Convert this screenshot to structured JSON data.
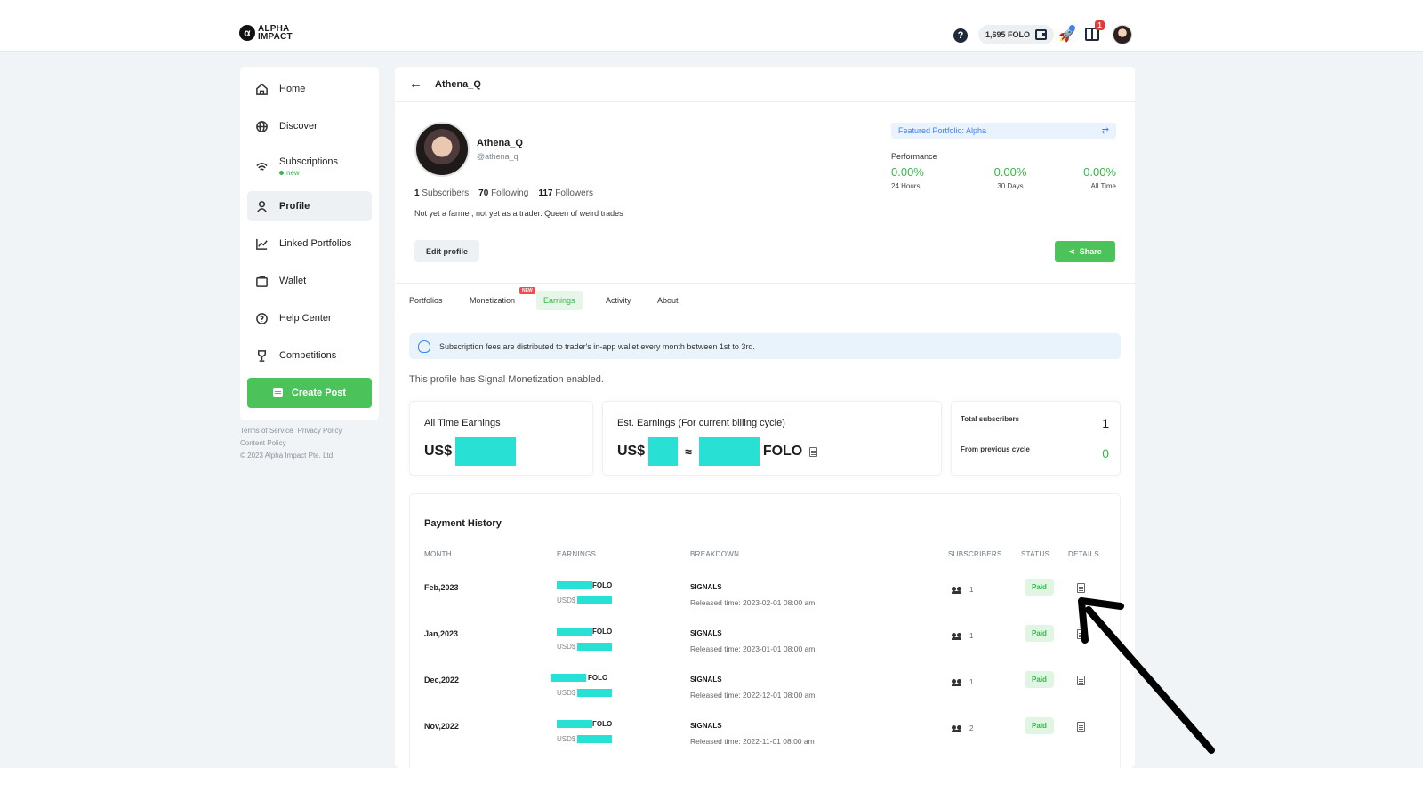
{
  "topbar": {
    "logo_line1": "ALPHA",
    "logo_line2": "IMPACT",
    "logo_mark": "α",
    "balance": "1,695 FOLO",
    "gift_badge": "1",
    "help_glyph": "?"
  },
  "sidebar": {
    "items": [
      {
        "label": "Home",
        "icon": "home-icon"
      },
      {
        "label": "Discover",
        "icon": "globe-icon"
      },
      {
        "label": "Subscriptions",
        "icon": "signal-icon",
        "tag": "new"
      },
      {
        "label": "Profile",
        "icon": "user-icon",
        "active": true
      },
      {
        "label": "Linked Portfolios",
        "icon": "chart-icon"
      },
      {
        "label": "Wallet",
        "icon": "wallet-icon"
      },
      {
        "label": "Help Center",
        "icon": "help-icon"
      },
      {
        "label": "Competitions",
        "icon": "trophy-icon"
      }
    ],
    "create_post": "Create Post",
    "footer": {
      "terms": "Terms of Service",
      "privacy": "Privacy Policy",
      "content": "Content Policy",
      "copyright": "© 2023 Alpha Impact Pte. Ltd"
    }
  },
  "header": {
    "title": "Athena_Q"
  },
  "profile": {
    "name": "Athena_Q",
    "handle": "@athena_q",
    "subscribers_count": "1",
    "subscribers_label": "Subscribers",
    "following_count": "70",
    "following_label": "Following",
    "followers_count": "117",
    "followers_label": "Followers",
    "bio": "Not yet a farmer, not yet as a trader. Queen of weird trades",
    "edit_label": "Edit profile",
    "featured": "Featured Portfolio: Alpha",
    "performance_label": "Performance",
    "performance": [
      {
        "value": "0.00%",
        "label": "24 Hours"
      },
      {
        "value": "0.00%",
        "label": "30 Days"
      },
      {
        "value": "0.00%",
        "label": "All Time"
      }
    ],
    "share_label": "Share"
  },
  "tabs": {
    "items": [
      "Portfolios",
      "Monetization",
      "Earnings",
      "Activity",
      "About"
    ],
    "new_tag": "NEW",
    "active": "Earnings"
  },
  "earnings": {
    "info": "Subscription fees are distributed to trader's in-app wallet every month between 1st to 3rd.",
    "note": "This profile has Signal Monetization enabled.",
    "all_time_title": "All Time Earnings",
    "est_title": "Est. Earnings (For current billing cycle)",
    "currency": "US$",
    "approx": "≈",
    "folo": "FOLO",
    "total_subscribers_label": "Total subscribers",
    "total_subscribers": "1",
    "previous_cycle_label": "From previous cycle",
    "previous_cycle": "0"
  },
  "history": {
    "title": "Payment History",
    "columns": [
      "MONTH",
      "EARNINGS",
      "BREAKDOWN",
      "SUBSCRIBERS",
      "STATUS",
      "DETAILS"
    ],
    "folo_unit": "FOLO",
    "usd_unit": "USD$",
    "rows": [
      {
        "month": "Feb,2023",
        "breakdown": "SIGNALS",
        "released": "Released time: 2023-02-01 08:00 am",
        "subscribers": "1",
        "status": "Paid"
      },
      {
        "month": "Jan,2023",
        "breakdown": "SIGNALS",
        "released": "Released time: 2023-01-01 08:00 am",
        "subscribers": "1",
        "status": "Paid"
      },
      {
        "month": "Dec,2022",
        "breakdown": "SIGNALS",
        "released": "Released time: 2022-12-01 08:00 am",
        "subscribers": "1",
        "status": "Paid"
      },
      {
        "month": "Nov,2022",
        "breakdown": "SIGNALS",
        "released": "Released time: 2022-11-01 08:00 am",
        "subscribers": "2",
        "status": "Paid"
      }
    ]
  },
  "colors": {
    "accent_green": "#4cc35a",
    "redaction": "#29e0d5",
    "link_blue": "#3b82f6"
  }
}
